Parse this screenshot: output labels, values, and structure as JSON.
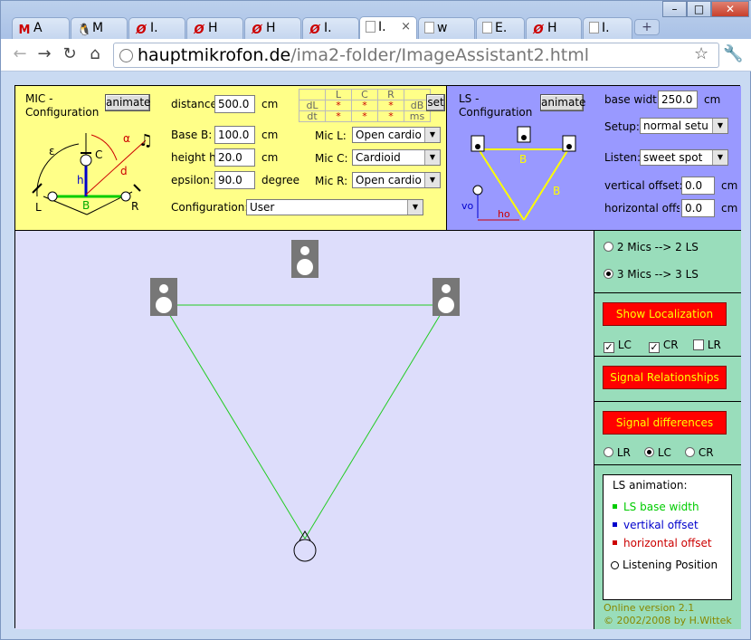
{
  "tabs": [
    {
      "icon": "gmail-icon",
      "label": "A"
    },
    {
      "icon": "linux-penguin-icon",
      "label": "M"
    },
    {
      "icon": "phi-icon",
      "label": "I."
    },
    {
      "icon": "phi-icon",
      "label": "H"
    },
    {
      "icon": "phi-icon",
      "label": "H"
    },
    {
      "icon": "phi-icon",
      "label": "I."
    },
    {
      "icon": "page-icon",
      "label": "I.",
      "active": true
    },
    {
      "icon": "page-icon",
      "label": "w"
    },
    {
      "icon": "page-icon",
      "label": "E."
    },
    {
      "icon": "phi-icon",
      "label": "H"
    },
    {
      "icon": "page-icon",
      "label": "I."
    }
  ],
  "toolbar": {
    "url_domain": "hauptmikrofon.de",
    "url_path": "/ima2-folder/ImageAssistant2.html"
  },
  "mic": {
    "title": "MIC -\nConfiguration",
    "animate_label": "animate",
    "distance_label": "distance",
    "distance_value": "500.0",
    "distance_unit": "cm",
    "base_label": "Base B:",
    "base_value": "100.0",
    "base_unit": "cm",
    "height_label": "height h:",
    "height_value": "20.0",
    "height_unit": "cm",
    "epsilon_label": "epsilon:",
    "epsilon_value": "90.0",
    "epsilon_unit": "degree",
    "config_label": "Configuration:",
    "config_value": "User",
    "micL_label": "Mic L:",
    "micL_value": "Open cardio",
    "micC_label": "Mic C:",
    "micC_value": "Cardioid",
    "micR_label": "Mic R:",
    "micR_value": "Open cardio",
    "table_head": [
      "L",
      "C",
      "R"
    ],
    "row1_label": "dL",
    "row1_unit": "dB",
    "row2_label": "dt",
    "row2_unit": "ms",
    "star": "*",
    "set_label": "set",
    "diagram": {
      "eps": "ε",
      "alpha": "α",
      "c": "C",
      "h": "h",
      "d": "d",
      "l": "L",
      "b": "B",
      "r": "R",
      "note": "♫"
    }
  },
  "ls": {
    "title": "LS -\nConfiguration",
    "animate_label": "animate",
    "basewidth_label": "base width",
    "basewidth_value": "250.0",
    "basewidth_unit": "cm",
    "setup_label": "Setup:",
    "setup_value": "normal setu",
    "listen_label": "Listen:",
    "listen_value": "sweet spot",
    "voffset_label": "vertical offset:",
    "voffset_value": "0.0",
    "voffset_unit": "cm",
    "hoffset_label": "horizontal offse",
    "hoffset_value": "0.0",
    "hoffset_unit": "cm",
    "diagram": {
      "b1": "B",
      "b2": "B",
      "vo": "vo",
      "ho": "ho"
    }
  },
  "side": {
    "radio1": "2 Mics --> 2 LS",
    "radio2": "3 Mics --> 3 LS",
    "show_localization": "Show Localization",
    "cb_lc": "LC",
    "cb_cr": "CR",
    "cb_lr": "LR",
    "signal_relationships": "Signal Relationships",
    "signal_differences": "Signal differences",
    "r_lr": "LR",
    "r_lc": "LC",
    "r_cr": "CR",
    "legend_title": "LS animation:",
    "legend": [
      {
        "label": "LS base width",
        "color": "#00cc00"
      },
      {
        "label": "vertikal offset",
        "color": "#0000cc"
      },
      {
        "label": "horizontal offset",
        "color": "#cc0000"
      }
    ],
    "listening_position": "Listening Position",
    "version": "Online version 2.1",
    "copyright": "© 2002/2008 by H.Wittek"
  },
  "colors": {
    "mic_panel": "#ffff88",
    "ls_panel": "#9999ff",
    "stage": "#ddddfb",
    "side": "#99ddbb",
    "red_button": "#ff0000",
    "button_text": "#ffff00"
  }
}
